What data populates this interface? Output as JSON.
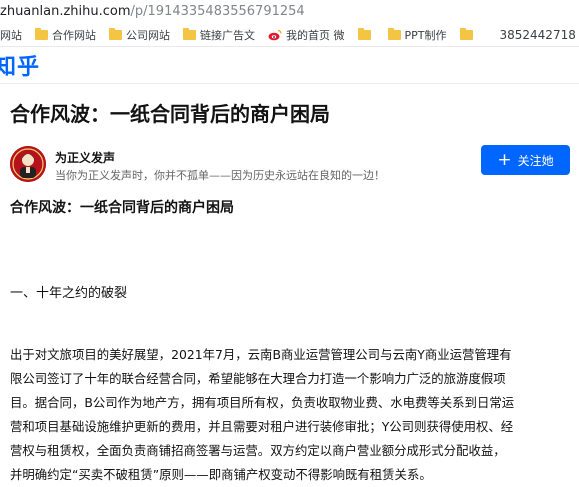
{
  "browser": {
    "url_host": "zhuanlan.zhihu.com",
    "url_path": "/p/1914335483556791254",
    "bookmarks": [
      {
        "label": "网站",
        "icon": "none"
      },
      {
        "label": "合作网站",
        "icon": "folder-icon"
      },
      {
        "label": "公司网站",
        "icon": "folder-icon"
      },
      {
        "label": "链接广告文",
        "icon": "folder-icon"
      },
      {
        "label": "我的首页 微",
        "icon": "weibo-icon"
      },
      {
        "label": "",
        "icon": "folder-icon"
      },
      {
        "label": "PPT制作",
        "icon": "folder-icon"
      },
      {
        "label": "",
        "icon": "folder-icon"
      }
    ],
    "bookmark_number": "3852442718"
  },
  "header": {
    "logo": "知乎"
  },
  "article": {
    "title": "合作风波：一纸合同背后的商户困局",
    "author_name": "为正义发声",
    "author_bio": "当你为正义发声时，你并不孤单——因为历史永远站在良知的一边！",
    "follow_label": "关注她",
    "subheading": "合作风波：一纸合同背后的商户困局",
    "section_title": "一、十年之约的破裂",
    "paragraph_lines": [
      "出于对文旅项目的美好展望，2021年7月，云南B商业运营管理公司与云南Y商业运营管理有",
      "限公司签订了十年的联合经营合同，希望能够在大理合力打造一个影响力广泛的旅游度假项",
      "目。据合同，B公司作为地产方，拥有项目所有权，负责收取物业费、水电费等关系到日常运",
      "营和项目基础设施维护更新的费用，并且需要对租户进行装修审批；Y公司则获得使用权、经",
      "营权与租赁权，全面负责商铺招商签署与运营。双方约定以商户营业额分成形式分配收益，",
      "并明确约定“买卖不破租赁”原则——即商铺产权变动不得影响既有租赁关系。"
    ]
  },
  "colors": {
    "brand": "#0066ff",
    "folder": "#f4c542"
  }
}
